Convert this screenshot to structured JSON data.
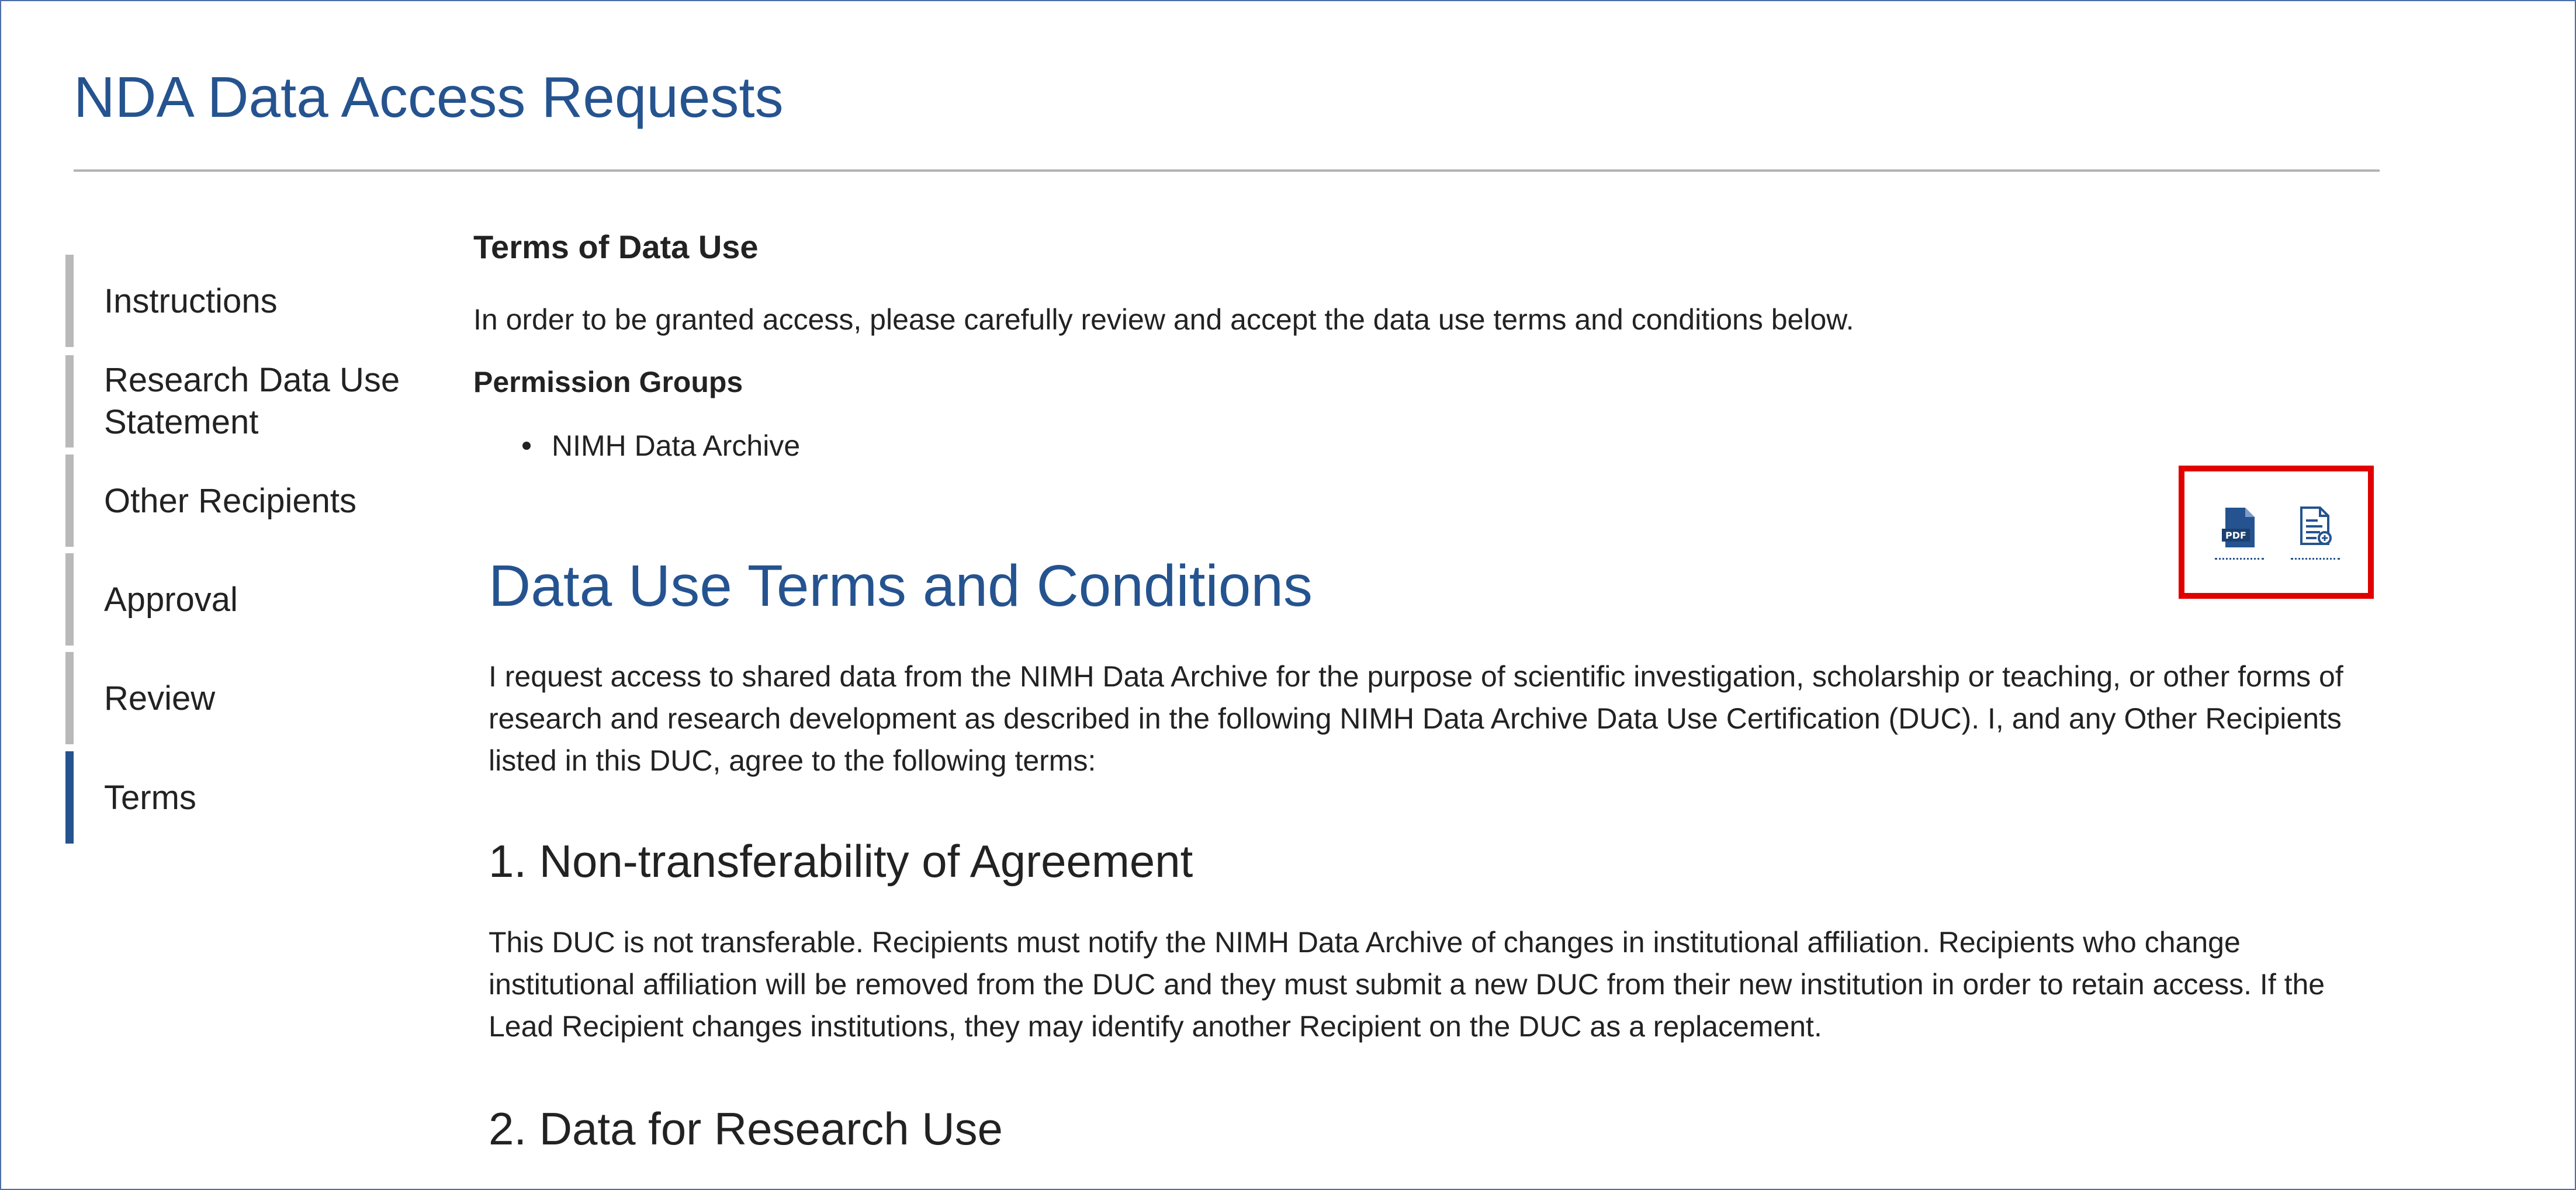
{
  "page": {
    "title": "NDA Data Access Requests"
  },
  "sidebar": {
    "items": [
      {
        "label": "Instructions"
      },
      {
        "label": "Research Data Use Statement"
      },
      {
        "label": "Other Recipients"
      },
      {
        "label": "Approval"
      },
      {
        "label": "Review"
      },
      {
        "label": "Terms",
        "active": true
      }
    ]
  },
  "main": {
    "terms_heading": "Terms of Data Use",
    "intro": "In order to be granted access, please carefully review and accept the data use terms and conditions below.",
    "permission_groups_heading": "Permission Groups",
    "permission_groups": [
      "NIMH Data Archive"
    ],
    "downloads": {
      "pdf_icon": "pdf-file-icon",
      "pdf_icon_text": "PDF",
      "doc_icon": "document-icon"
    },
    "section_title": "Data Use Terms and Conditions",
    "section_intro": "I request access to shared data from the NIMH Data Archive for the purpose of scientific investigation, scholarship or teaching, or other forms of research and research development as described in the following NIMH Data Archive Data Use Certification (DUC). I, and any Other Recipients listed in this DUC, agree to the following terms:",
    "sections": [
      {
        "heading": "1. Non-transferability of Agreement",
        "body": "This DUC is not transferable. Recipients must notify the NIMH Data Archive of changes in institutional affiliation. Recipients who change institutional affiliation will be removed from the DUC and they must submit a new DUC from their new institution in order to retain access. If the Lead Recipient changes institutions, they may identify another Recipient on the DUC as a replacement."
      },
      {
        "heading": "2. Data for Research Use"
      }
    ]
  },
  "colors": {
    "brand_blue": "#25538f",
    "highlight_red": "#e00000",
    "nav_inactive": "#b9b9b9"
  }
}
